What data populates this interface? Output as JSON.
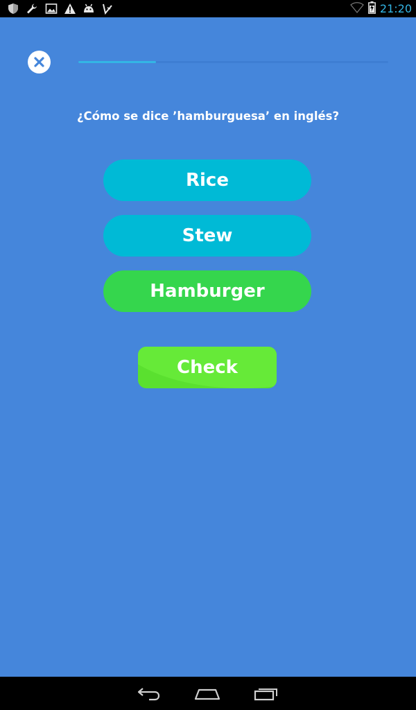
{
  "status_bar": {
    "time": "21:20",
    "left_icons": [
      "shield-icon",
      "wrench-icon",
      "image-icon",
      "warning-icon",
      "android-icon",
      "checklist-icon"
    ],
    "right_icons": [
      "wifi-icon",
      "battery-charging-icon"
    ]
  },
  "top_bar": {
    "close_icon": "close-icon",
    "progress_fraction": 0.25
  },
  "question": {
    "text": "¿Cómo se dice ’hamburguesa’ en inglés?"
  },
  "options": [
    {
      "label": "Rice",
      "selected": false,
      "color": "#00bad6"
    },
    {
      "label": "Stew",
      "selected": false,
      "color": "#00bad6"
    },
    {
      "label": "Hamburger",
      "selected": true,
      "color": "#35d64d"
    }
  ],
  "check_button": {
    "label": "Check",
    "color": "#5ae02f"
  },
  "nav_bar": {
    "icons": [
      "back-icon",
      "home-icon",
      "recent-apps-icon"
    ]
  },
  "colors": {
    "background": "#4586db",
    "accent": "#33b5e5"
  }
}
